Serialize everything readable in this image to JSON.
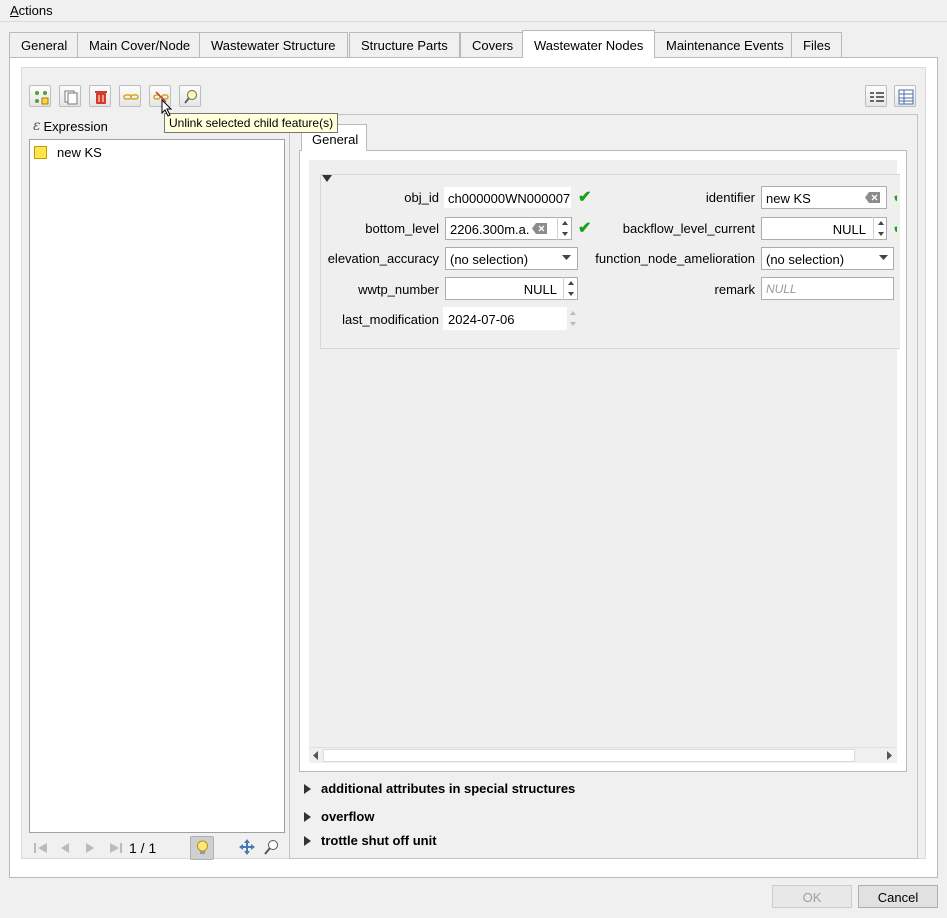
{
  "menu": {
    "actions_label": "Actions"
  },
  "tabs": [
    {
      "label": "General"
    },
    {
      "label": "Main Cover/Node"
    },
    {
      "label": "Wastewater Structure"
    },
    {
      "label": "Structure Parts"
    },
    {
      "label": "Covers"
    },
    {
      "label": "Wastewater Nodes"
    },
    {
      "label": "Maintenance Events"
    },
    {
      "label": "Files"
    }
  ],
  "toolbar": {
    "tooltip": "Unlink selected child feature(s)",
    "icons": [
      "add-child-icon",
      "duplicate-icon",
      "delete-icon",
      "link-icon",
      "unlink-icon",
      "zoom-feature-icon"
    ],
    "view_icons": [
      "form-view-icon",
      "table-view-icon"
    ]
  },
  "list": {
    "expression_label": "Expression",
    "items": [
      {
        "label": "new KS",
        "color": "#ffe34d"
      }
    ],
    "pager": "1 / 1"
  },
  "subtab": {
    "label": "General"
  },
  "form": {
    "obj_id": {
      "label": "obj_id",
      "value": "ch000000WN000007"
    },
    "identifier": {
      "label": "identifier",
      "value": "new KS"
    },
    "bottom_level": {
      "label": "bottom_level",
      "value": "2206.300m.a."
    },
    "backflow_level_current": {
      "label": "backflow_level_current",
      "value": "NULL"
    },
    "elevation_accuracy": {
      "label": "elevation_accuracy",
      "value": "(no selection)"
    },
    "function_node_amelioration": {
      "label": "function_node_amelioration",
      "value": "(no selection)"
    },
    "wwtp_number": {
      "label": "wwtp_number",
      "value": "NULL"
    },
    "remark": {
      "label": "remark",
      "placeholder": "NULL"
    },
    "last_modification": {
      "label": "last_modification",
      "value": "2024-07-06"
    }
  },
  "sections": [
    {
      "label": "additional attributes in special structures"
    },
    {
      "label": "overflow"
    },
    {
      "label": "trottle shut off unit"
    }
  ],
  "buttons": {
    "ok": "OK",
    "cancel": "Cancel"
  },
  "colors": {
    "check": "#18a018",
    "delete_red": "#d33a2c",
    "feature_yellow": "#ffe34d"
  }
}
